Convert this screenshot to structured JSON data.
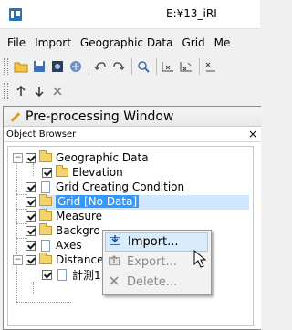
{
  "window": {
    "title": "E:¥13_iRI",
    "app_icon": "iric-app-icon"
  },
  "menu": [
    "File",
    "Import",
    "Geographic Data",
    "Grid",
    "Me"
  ],
  "toolbar1": [
    "open-folder-icon",
    "save-icon",
    "snapshot-icon",
    "network-icon",
    "undo-icon",
    "redo-icon",
    "zoom-icon",
    "axis-x-icon",
    "axis-xy-icon",
    "axis-partial-icon"
  ],
  "toolbar2": [
    "arrow-up-icon",
    "arrow-down-icon",
    "delete-icon"
  ],
  "pre_window": {
    "title": "Pre-processing Window",
    "object_browser": "Object Browser",
    "close": "×"
  },
  "tree": [
    {
      "label": "Geographic Data",
      "icon": "folder"
    },
    {
      "label": "Elevation",
      "icon": "folder"
    },
    {
      "label": "Grid Creating Condition",
      "icon": "doc"
    },
    {
      "label": "Grid [No Data]",
      "icon": "folder"
    },
    {
      "label": "Measure",
      "icon": "folder"
    },
    {
      "label": "Backgro",
      "icon": "folder"
    },
    {
      "label": "Axes",
      "icon": "doc"
    },
    {
      "label": "Distance",
      "icon": "folder"
    },
    {
      "label": "計測1",
      "icon": "doc"
    }
  ],
  "context_menu": {
    "import": "Import...",
    "export": "Export...",
    "delete": "Delete..."
  },
  "colors": {
    "selection": "#3399ff",
    "menu_highlight": "#d9ecfb",
    "folder": "#f5d36b"
  }
}
